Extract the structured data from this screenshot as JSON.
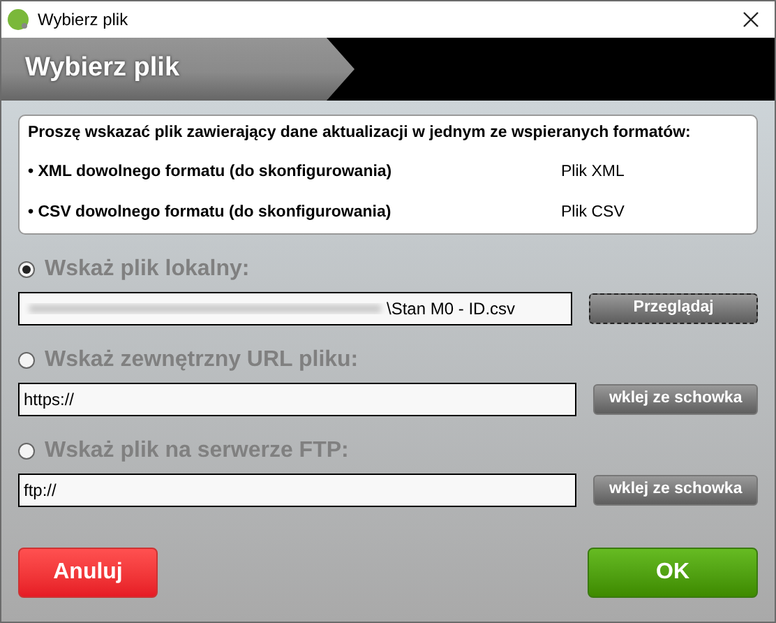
{
  "window": {
    "title": "Wybierz plik"
  },
  "header": {
    "title": "Wybierz plik"
  },
  "info": {
    "intro": "Proszę wskazać plik zawierający dane aktualizacji w jednym ze wspieranych formatów:",
    "formats": [
      {
        "name": "• XML dowolnego formatu (do skonfigurowania)",
        "type": "Plik XML"
      },
      {
        "name": "• CSV dowolnego formatu (do skonfigurowania)",
        "type": "Plik CSV"
      }
    ]
  },
  "sources": [
    {
      "label": "Wskaż plik lokalny:",
      "selected": true,
      "value": "\\Stan M0 - ID.csv",
      "blurred_prefix": true,
      "button": {
        "label": "Przeglądaj",
        "focused": true
      }
    },
    {
      "label": "Wskaż zewnętrzny URL pliku:",
      "selected": false,
      "value": "https://",
      "blurred_prefix": false,
      "button": {
        "label": "wklej ze schowka",
        "focused": false
      }
    },
    {
      "label": "Wskaż plik na serwerze FTP:",
      "selected": false,
      "value": "ftp://",
      "blurred_prefix": false,
      "button": {
        "label": "wklej ze schowka",
        "focused": false
      }
    }
  ],
  "buttons": {
    "cancel": "Anuluj",
    "ok": "OK"
  }
}
